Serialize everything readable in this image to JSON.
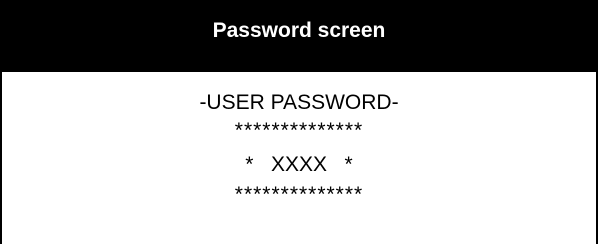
{
  "header": {
    "title": "Password screen"
  },
  "content": {
    "label": "-USER PASSWORD-",
    "stars_top": "**************",
    "password_line": "*   XXXX   *",
    "stars_bottom": "**************"
  }
}
